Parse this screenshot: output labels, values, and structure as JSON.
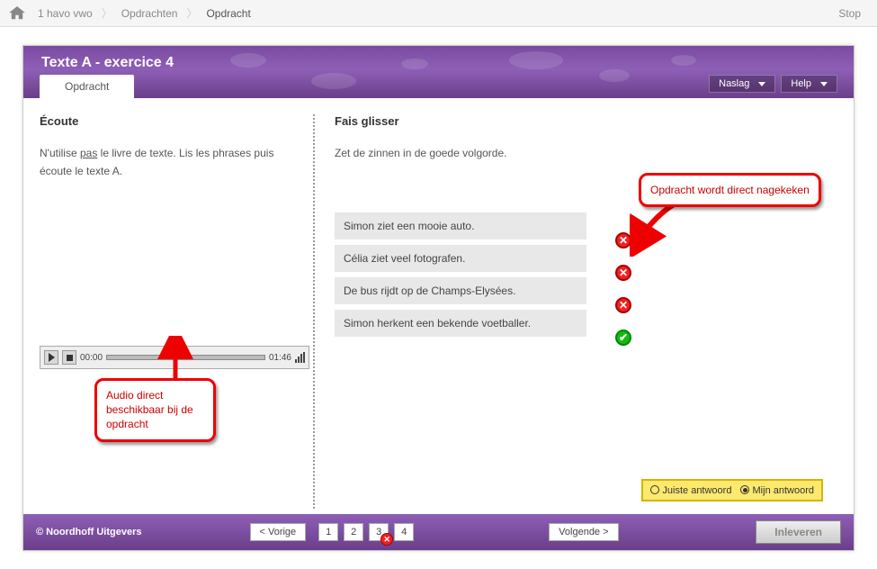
{
  "breadcrumb": {
    "level": "1 havo vwo",
    "section": "Opdrachten",
    "current": "Opdracht"
  },
  "stop_label": "Stop",
  "header": {
    "title": "Texte A - exercice 4",
    "tab_label": "Opdracht",
    "naslag": "Naslag",
    "help": "Help"
  },
  "left": {
    "title": "Écoute",
    "instr_prefix": "N'utilise ",
    "instr_underlined": "pas",
    "instr_suffix": " le livre de texte. Lis les phrases puis écoute le texte A.",
    "audio": {
      "current": "00:00",
      "total": "01:46"
    }
  },
  "right": {
    "title": "Fais glisser",
    "instr": "Zet de zinnen in de goede volgorde.",
    "items": [
      {
        "text": "Simon ziet een mooie auto.",
        "status": "bad"
      },
      {
        "text": "Célia ziet veel fotografen.",
        "status": "bad"
      },
      {
        "text": "De bus rijdt op de Champs-Elysées.",
        "status": "bad"
      },
      {
        "text": "Simon herkent een bekende voetballer.",
        "status": "good"
      }
    ]
  },
  "answer_toggle": {
    "correct": "Juiste antwoord",
    "mine": "Mijn antwoord"
  },
  "footer": {
    "copyright": "© Noordhoff Uitgevers",
    "prev": "< Vorige",
    "next": "Volgende >",
    "pages": [
      "1",
      "2",
      "3",
      "4"
    ],
    "submit": "Inleveren"
  },
  "callouts": {
    "audio": "Audio direct beschikbaar bij de opdracht",
    "graded": "Opdracht wordt direct nagekeken"
  },
  "icons": {
    "cross": "✕",
    "check": "✔"
  }
}
